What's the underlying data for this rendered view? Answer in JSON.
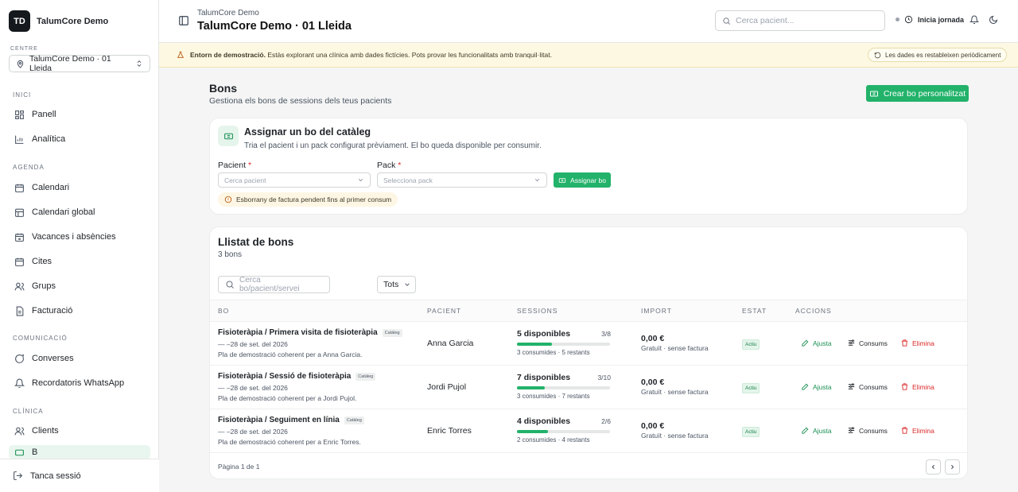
{
  "brand": {
    "initials": "TD",
    "name": "TalumCore Demo"
  },
  "centre": {
    "label": "CENTRE",
    "value": "TalumCore Demo · 01 Lleida"
  },
  "sidebar": {
    "sections": [
      {
        "title": "INICI"
      },
      {
        "title": "AGENDA"
      },
      {
        "title": "COMUNICACIÓ"
      },
      {
        "title": "CLÍNICA"
      }
    ],
    "items": [
      {
        "label": "Panell",
        "icon": "dashboard-icon"
      },
      {
        "label": "Analítica",
        "icon": "chart-icon"
      },
      {
        "label": "Calendari",
        "icon": "calendar-icon"
      },
      {
        "label": "Calendari global",
        "icon": "calendar-grid-icon"
      },
      {
        "label": "Vacances i absències",
        "icon": "calendar-off-icon"
      },
      {
        "label": "Cites",
        "icon": "calendar-check-icon"
      },
      {
        "label": "Grups",
        "icon": "users-icon"
      },
      {
        "label": "Facturació",
        "icon": "invoice-icon"
      },
      {
        "label": "Converses",
        "icon": "chat-icon"
      },
      {
        "label": "Recordatoris WhatsApp",
        "icon": "bell-icon"
      },
      {
        "label": "Clients",
        "icon": "users-icon"
      },
      {
        "label": "B",
        "icon": "ticket-icon"
      }
    ],
    "logout": "Tanca sessió"
  },
  "header": {
    "sub": "TalumCore Demo",
    "title": "TalumCore Demo · 01 Lleida",
    "search_placeholder": "Cerca pacient...",
    "jornada": "Inicia jornada"
  },
  "banner": {
    "bold": "Entorn de demostració.",
    "text": "Estàs explorant una clínica amb dades fictícies. Pots provar les funcionalitats amb tranquil·litat.",
    "pill": "Les dades es restableixen periòdicament"
  },
  "page": {
    "title": "Bons",
    "subtitle": "Gestiona els bons de sessions dels teus pacients",
    "create_button": "Crear bo personalitzat"
  },
  "assign": {
    "title": "Assignar un bo del catàleg",
    "subtitle": "Tria el pacient i un pack configurat prèviament. El bo queda disponible per consumir.",
    "patient_label": "Pacient",
    "patient_placeholder": "Cerca pacient",
    "pack_label": "Pack",
    "pack_placeholder": "Selecciona pack",
    "required_mark": "*",
    "button": "Assignar bo",
    "warning": "Esborrany de factura pendent fins al primer consum"
  },
  "list": {
    "title": "Llistat de bons",
    "count": "3 bons",
    "search_placeholder": "Cerca bo/pacient/servei",
    "filter": "Tots",
    "columns": [
      "BO",
      "PACIENT",
      "SESSIONS",
      "IMPORT",
      "ESTAT",
      "ACCIONS"
    ],
    "actions": {
      "adjust": "Ajusta",
      "consumptions": "Consums",
      "delete": "Elimina"
    },
    "rows": [
      {
        "name": "Fisioteràpia / Primera visita de fisioteràpia",
        "badge": "Catàleg",
        "date": "— –28 de set. del 2026",
        "desc": "Pla de demostració coherent per a Anna Garcia.",
        "patient": "Anna Garcia",
        "available": "5 disponibles",
        "ratio": "3/8",
        "progress": 0.375,
        "stats": "3 consumides · 5 restants",
        "amount": "0,00 €",
        "amount_sub": "Gratuït · sense factura",
        "status": "Actiu"
      },
      {
        "name": "Fisioteràpia / Sessió de fisioteràpia",
        "badge": "Catàleg",
        "date": "— –28 de set. del 2026",
        "desc": "Pla de demostració coherent per a Jordi Pujol.",
        "patient": "Jordi Pujol",
        "available": "7 disponibles",
        "ratio": "3/10",
        "progress": 0.3,
        "stats": "3 consumides · 7 restants",
        "amount": "0,00 €",
        "amount_sub": "Gratuït · sense factura",
        "status": "Actiu"
      },
      {
        "name": "Fisioteràpia / Seguiment en línia",
        "badge": "Catàleg",
        "date": "— –28 de set. del 2026",
        "desc": "Pla de demostració coherent per a Enric Torres.",
        "patient": "Enric Torres",
        "available": "4 disponibles",
        "ratio": "2/6",
        "progress": 0.333,
        "stats": "2 consumides · 4 restants",
        "amount": "0,00 €",
        "amount_sub": "Gratuït · sense factura",
        "status": "Actiu"
      }
    ],
    "pager": "Pàgina 1 de 1"
  },
  "colors": {
    "accent": "#22b26a",
    "danger": "#dc2626",
    "banner": "#fdf8e1"
  }
}
